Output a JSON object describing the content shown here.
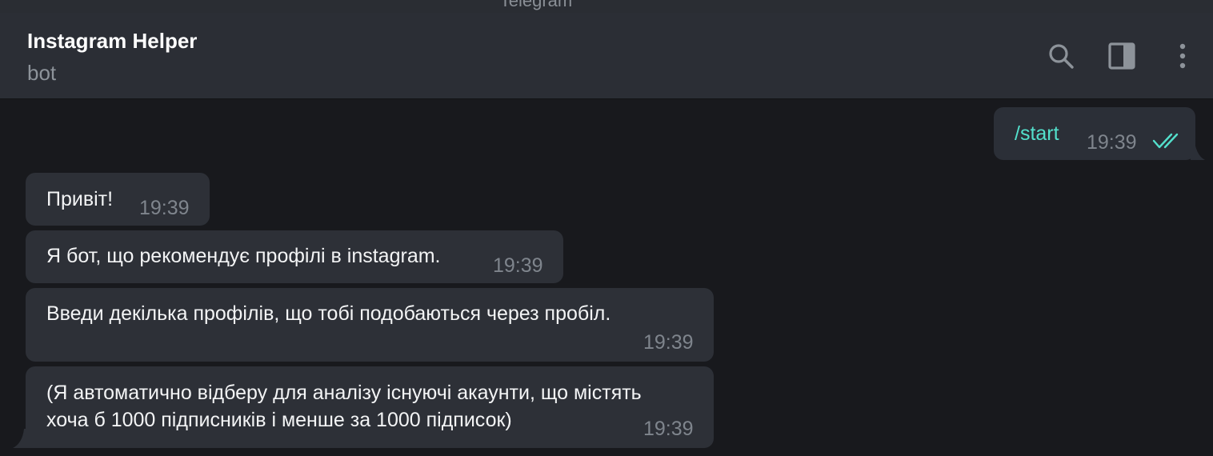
{
  "window": {
    "title": "Telegram"
  },
  "header": {
    "chat_name": "Instagram Helper",
    "chat_status": "bot",
    "icons": [
      "search-icon",
      "side-panel-icon",
      "more-vertical-icon"
    ]
  },
  "colors": {
    "background": "#18191d",
    "header": "#2b2e35",
    "bubble": "#2d3037",
    "accent": "#53e0cc",
    "muted": "#7f858d"
  },
  "messages": [
    {
      "direction": "outgoing",
      "text": "/start",
      "time": "19:39",
      "status": "read"
    },
    {
      "direction": "incoming",
      "text": "Привіт!",
      "time": "19:39"
    },
    {
      "direction": "incoming",
      "text": "Я бот, що рекомендує профілі в instagram.",
      "time": "19:39"
    },
    {
      "direction": "incoming",
      "text": "Введи декілька профілів, що тобі подобаються через пробіл.",
      "time": "19:39"
    },
    {
      "direction": "incoming",
      "text_lines": [
        "(Я автоматично відберу для аналізу існуючі акаунти, що містять",
        "хоча б 1000 підписників і менше за 1000 підписок)"
      ],
      "time": "19:39"
    }
  ]
}
